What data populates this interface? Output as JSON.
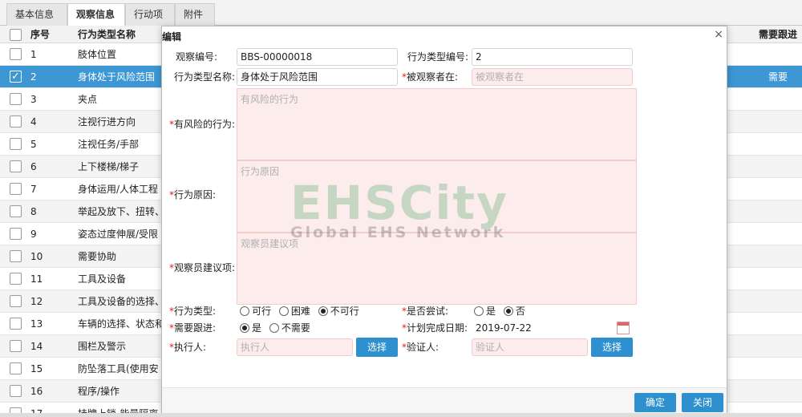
{
  "tabs": [
    "基本信息",
    "观察信息",
    "行动项",
    "附件"
  ],
  "grid": {
    "headers": {
      "no": "序号",
      "name": "行为类型名称",
      "need": "需要跟进"
    },
    "rows": [
      {
        "no": "1",
        "name": "肢体位置",
        "need": ""
      },
      {
        "no": "2",
        "name": "身体处于风险范围",
        "need": "需要"
      },
      {
        "no": "3",
        "name": "夹点",
        "need": ""
      },
      {
        "no": "4",
        "name": "注视行进方向",
        "need": ""
      },
      {
        "no": "5",
        "name": "注视任务/手部",
        "need": ""
      },
      {
        "no": "6",
        "name": "上下楼梯/梯子",
        "need": ""
      },
      {
        "no": "7",
        "name": "身体运用/人体工程",
        "need": ""
      },
      {
        "no": "8",
        "name": "举起及放下、扭转、",
        "need": ""
      },
      {
        "no": "9",
        "name": "姿态过度伸展/受限",
        "need": ""
      },
      {
        "no": "10",
        "name": "需要协助",
        "need": ""
      },
      {
        "no": "11",
        "name": "工具及设备",
        "need": ""
      },
      {
        "no": "12",
        "name": "工具及设备的选择、",
        "need": ""
      },
      {
        "no": "13",
        "name": "车辆的选择、状态和",
        "need": ""
      },
      {
        "no": "14",
        "name": "围栏及警示",
        "need": ""
      },
      {
        "no": "15",
        "name": "防坠落工具(使用安",
        "need": ""
      },
      {
        "no": "16",
        "name": "程序/操作",
        "need": ""
      },
      {
        "no": "17",
        "name": "挂牌上锁-能量隔离",
        "need": ""
      }
    ]
  },
  "modal": {
    "title": "编辑",
    "close": "×",
    "labels": {
      "obs_no": "观察编号:",
      "type_no": "行为类型编号:",
      "type_name": "行为类型名称:",
      "observed": "被观察者在:",
      "risky": "有风险的行为:",
      "reason": "行为原因:",
      "suggest": "观察员建议项:",
      "behavior_type": "行为类型:",
      "tried": "是否尝试:",
      "follow": "需要跟进:",
      "plan_date": "计划完成日期:",
      "executor": "执行人:",
      "verifier": "验证人:"
    },
    "required_mark": "*",
    "values": {
      "obs_no": "BBS-00000018",
      "type_no": "2",
      "type_name": "身体处于风险范围",
      "plan_date": "2019-07-22"
    },
    "placeholders": {
      "observed": "被观察者在",
      "risky": "有风险的行为",
      "reason": "行为原因",
      "suggest": "观察员建议项",
      "executor": "执行人",
      "verifier": "验证人"
    },
    "radios": {
      "behavior_type": {
        "options": [
          "可行",
          "困难",
          "不可行"
        ],
        "selected": "不可行"
      },
      "tried": {
        "options": [
          "是",
          "否"
        ],
        "selected": "否"
      },
      "follow": {
        "options": [
          "是",
          "不需要"
        ],
        "selected": "是"
      }
    },
    "buttons": {
      "select": "选择",
      "confirm": "确定",
      "close": "关闭"
    }
  },
  "watermark": {
    "line1": "EHSCity",
    "line2": "Global EHS Network"
  },
  "colors": {
    "accent": "#2e90cf",
    "selected_row": "#3c97d4",
    "required_bg": "#fdecec",
    "required_star": "#dd2222"
  }
}
